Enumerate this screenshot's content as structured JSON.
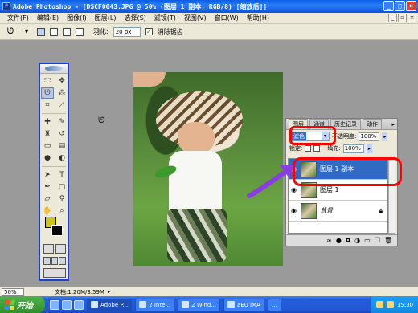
{
  "window": {
    "title": "Adobe Photoshop - [DSCF0043.JPG @ 50% (图层 1 副本, RGB/8) [缩放后]]"
  },
  "menubar": {
    "items": [
      "文件(F)",
      "编辑(E)",
      "图像(I)",
      "图层(L)",
      "选择(S)",
      "滤镜(T)",
      "视图(V)",
      "窗口(W)",
      "帮助(H)"
    ]
  },
  "options": {
    "feather_label": "羽化:",
    "feather_value": "20 px",
    "antialias_label": "消除锯齿",
    "antialias_checked": true
  },
  "toolbox": {
    "foreground_color": "#c7c51e",
    "background_color": "#000000"
  },
  "layers_panel": {
    "tabs": [
      "图层",
      "通道",
      "历史记录",
      "动作"
    ],
    "blend_mode": "滤色",
    "opacity_label": "不透明度:",
    "opacity_value": "100%",
    "fill_label": "填充:",
    "fill_value": "100%",
    "lock_label": "锁定:",
    "layers": [
      {
        "name": "图层 1 副本",
        "selected": true,
        "visible": true
      },
      {
        "name": "图层 1",
        "selected": false,
        "visible": true
      },
      {
        "name": "背景",
        "selected": false,
        "visible": true,
        "locked": true
      }
    ],
    "bottom_icons": [
      "link-icon",
      "fx-icon",
      "mask-icon",
      "adjustment-icon",
      "folder-icon",
      "new-layer-icon",
      "trash-icon"
    ]
  },
  "annotation": {
    "highlight_color": "#ff0000",
    "arrow_color": "#8a3de0"
  },
  "statusbar": {
    "zoom": "50%",
    "doc_info": "文档:1.20M/3.59M"
  },
  "taskbar": {
    "start_label": "开始",
    "buttons": [
      "Adobe P...",
      "2 Inte...",
      "2 Wind...",
      "aEU iMA",
      "..."
    ],
    "clock": "15:30"
  }
}
